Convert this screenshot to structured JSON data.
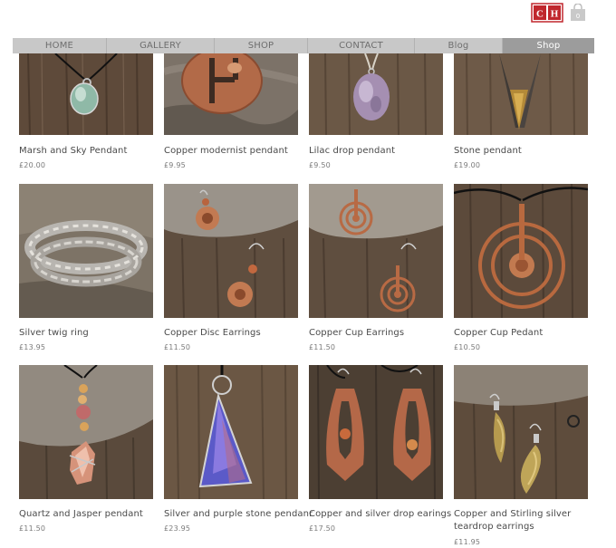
{
  "header": {
    "logo_text": "CH",
    "cart_count": "0"
  },
  "nav": [
    "HOME",
    "GALLERY",
    "SHOP",
    "CONTACT",
    "Blog",
    "Shop"
  ],
  "products": [
    {
      "name": "Marsh and Sky Pendant",
      "price": "£20.00"
    },
    {
      "name": "Copper modernist pendant",
      "price": "£9.95"
    },
    {
      "name": "Lilac drop pendant",
      "price": "£9.50"
    },
    {
      "name": "Stone pendant",
      "price": "£19.00"
    },
    {
      "name": "Silver twig ring",
      "price": "£13.95"
    },
    {
      "name": "Copper Disc Earrings",
      "price": "£11.50"
    },
    {
      "name": "Copper Cup Earrings",
      "price": "£11.50"
    },
    {
      "name": "Copper Cup Pedant",
      "price": "£10.50"
    },
    {
      "name": "Quartz and Jasper pendant",
      "price": "£11.50"
    },
    {
      "name": "Silver and purple stone pendanr",
      "price": "£23.95"
    },
    {
      "name": "Copper and silver drop earings",
      "price": "£17.50"
    },
    {
      "name": "Copper and Stirling silver teardrop earrings",
      "price": "£11.95"
    }
  ],
  "colors": {
    "nav_bg": "#c8c8c8",
    "nav_active": "#9c9c9c",
    "logo_red": "#c0272d"
  }
}
